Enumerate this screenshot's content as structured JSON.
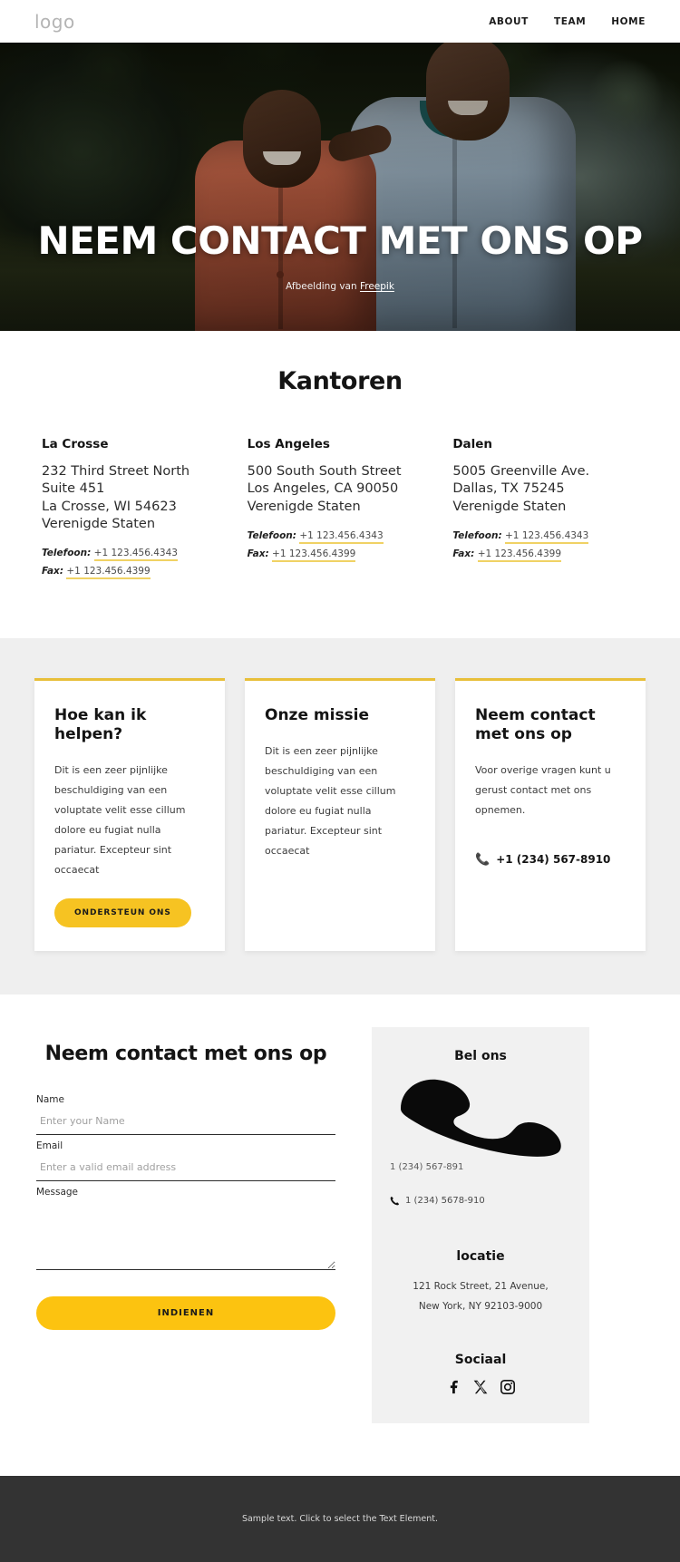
{
  "header": {
    "logo": "logo",
    "nav": [
      {
        "label": "ABOUT"
      },
      {
        "label": "TEAM"
      },
      {
        "label": "HOME"
      }
    ]
  },
  "hero": {
    "title": "NEEM CONTACT MET ONS OP",
    "caption_prefix": "Afbeelding van ",
    "caption_link": "Freepik"
  },
  "offices": {
    "title": "Kantoren",
    "items": [
      {
        "name": "La Crosse",
        "address": "232 Third Street North Suite 451\nLa Crosse, WI 54623\nVerenigde Staten",
        "phone_label": "Telefoon:",
        "phone": "+1 123.456.4343",
        "fax_label": "Fax:",
        "fax": "+1 123.456.4399"
      },
      {
        "name": "Los Angeles",
        "address": "500 South South Street\nLos Angeles, CA 90050\nVerenigde Staten",
        "phone_label": "Telefoon:",
        "phone": "+1 123.456.4343",
        "fax_label": "Fax:",
        "fax": "+1 123.456.4399"
      },
      {
        "name": "Dalen",
        "address": "5005 Greenville Ave.\nDallas, TX 75245\nVerenigde Staten",
        "phone_label": "Telefoon:",
        "phone": "+1 123.456.4343",
        "fax_label": "Fax:",
        "fax": "+1 123.456.4399"
      }
    ]
  },
  "cards": [
    {
      "title": "Hoe kan ik helpen?",
      "text": "Dit is een zeer pijnlijke beschuldiging van een voluptate velit esse cillum dolore eu fugiat nulla pariatur. Excepteur sint occaecat",
      "button": "ONDERSTEUN ONS"
    },
    {
      "title": "Onze missie",
      "text": "Dit is een zeer pijnlijke beschuldiging van een voluptate velit esse cillum dolore eu fugiat nulla pariatur. Excepteur sint occaecat"
    },
    {
      "title": "Neem contact met ons op",
      "text": "Voor overige vragen kunt u gerust contact met ons opnemen.",
      "phone": "+1 (234) 567-8910"
    }
  ],
  "contact": {
    "form_title": "Neem contact met ons op",
    "fields": {
      "name_label": "Name",
      "name_placeholder": "Enter your Name",
      "name_value": "",
      "email_label": "Email",
      "email_placeholder": "Enter a valid email address",
      "email_value": "",
      "message_label": "Message",
      "message_placeholder": "",
      "message_value": ""
    },
    "submit_label": "INDIENEN",
    "info": {
      "call_title": "Bel ons",
      "phone_plain": "1 (234) 567-891",
      "phone_secondary": "1 (234) 5678-910",
      "location_title": "locatie",
      "location_address": "121 Rock Street, 21 Avenue,\nNew York, NY 92103-9000",
      "social_title": "Sociaal",
      "social": [
        {
          "name": "facebook"
        },
        {
          "name": "x-twitter"
        },
        {
          "name": "instagram"
        }
      ]
    }
  },
  "footer": {
    "text": "Sample text. Click to select the Text Element."
  },
  "colors": {
    "accent_yellow": "#f6c322",
    "submit_yellow": "#fcc310",
    "card_border": "#e8bf3a",
    "link_underline": "#f0d264",
    "section_gray": "#efefef",
    "info_gray": "#f1f1f1",
    "footer_dark": "#333333"
  }
}
